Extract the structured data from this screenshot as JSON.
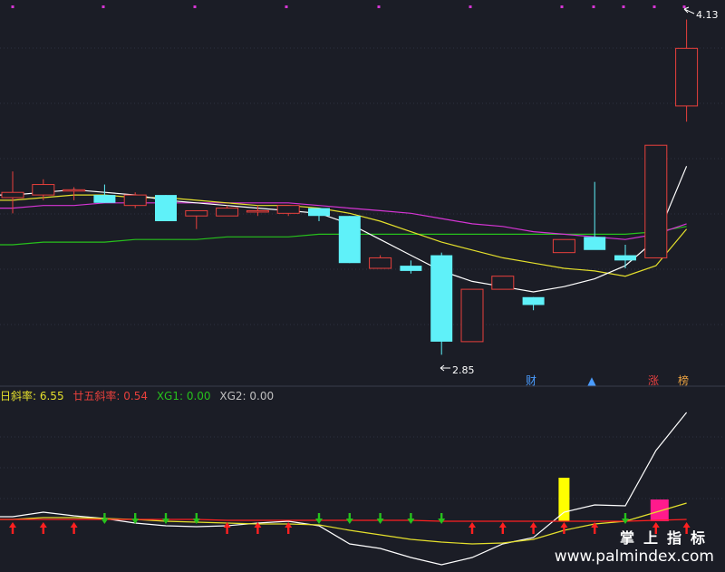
{
  "colors": {
    "background": "#1b1d26",
    "grid": "#2e3140",
    "up": "#e8403c",
    "down": "#5ff1f9",
    "ma5": "#ffffff",
    "ma10": "#e5e02c",
    "ma20": "#d535d4",
    "ma60": "#27c11c",
    "marker": "#d535d4",
    "badge_red": "#e34040",
    "badge_orange": "#e8a040",
    "badge_blue": "#4a9cff"
  },
  "price_labels": {
    "high": "4.13",
    "low": "2.85"
  },
  "badges": [
    {
      "text": "财",
      "color": "#4a9cff"
    },
    {
      "text": "▲",
      "color": "#4a9cff"
    },
    {
      "text": "涨",
      "color": "#e34040"
    },
    {
      "text": "榜",
      "color": "#e8a040"
    }
  ],
  "indicator": {
    "items": [
      {
        "label": "日斜率: ",
        "value": "6.55",
        "color": "#e5e02c"
      },
      {
        "label": "廿五斜率: ",
        "value": "0.54",
        "color": "#e8403c"
      },
      {
        "label": "XG1: ",
        "value": "0.00",
        "color": "#27c11c"
      },
      {
        "label": "XG2: ",
        "value": "0.00",
        "color": "#c0c0c0"
      }
    ]
  },
  "watermark": {
    "cn": "掌上指标",
    "url": "www.palmindex.com"
  },
  "chart_data": {
    "type": "candlestick",
    "ohlc": [
      {
        "open": 3.45,
        "high": 3.55,
        "low": 3.39,
        "close": 3.47
      },
      {
        "open": 3.46,
        "high": 3.52,
        "low": 3.44,
        "close": 3.5
      },
      {
        "open": 3.48,
        "high": 3.49,
        "low": 3.44,
        "close": 3.48
      },
      {
        "open": 3.46,
        "high": 3.5,
        "low": 3.43,
        "close": 3.43
      },
      {
        "open": 3.42,
        "high": 3.47,
        "low": 3.41,
        "close": 3.46
      },
      {
        "open": 3.46,
        "high": 3.46,
        "low": 3.36,
        "close": 3.36
      },
      {
        "open": 3.38,
        "high": 3.4,
        "low": 3.33,
        "close": 3.4
      },
      {
        "open": 3.38,
        "high": 3.42,
        "low": 3.38,
        "close": 3.41
      },
      {
        "open": 3.4,
        "high": 3.42,
        "low": 3.38,
        "close": 3.4
      },
      {
        "open": 3.39,
        "high": 3.42,
        "low": 3.38,
        "close": 3.42
      },
      {
        "open": 3.41,
        "high": 3.41,
        "low": 3.36,
        "close": 3.38
      },
      {
        "open": 3.38,
        "high": 3.38,
        "low": 3.2,
        "close": 3.2
      },
      {
        "open": 3.18,
        "high": 3.23,
        "low": 3.18,
        "close": 3.22
      },
      {
        "open": 3.19,
        "high": 3.21,
        "low": 3.16,
        "close": 3.17
      },
      {
        "open": 3.23,
        "high": 3.24,
        "low": 2.85,
        "close": 2.9
      },
      {
        "open": 2.9,
        "high": 3.1,
        "low": 2.9,
        "close": 3.1
      },
      {
        "open": 3.1,
        "high": 3.14,
        "low": 3.1,
        "close": 3.15
      },
      {
        "open": 3.07,
        "high": 3.07,
        "low": 3.02,
        "close": 3.04
      },
      {
        "open": 3.24,
        "high": 3.29,
        "low": 3.24,
        "close": 3.29
      },
      {
        "open": 3.3,
        "high": 3.51,
        "low": 3.28,
        "close": 3.25
      },
      {
        "open": 3.23,
        "high": 3.27,
        "low": 3.18,
        "close": 3.21
      },
      {
        "open": 3.22,
        "high": 3.65,
        "low": 3.22,
        "close": 3.65
      },
      {
        "open": 3.8,
        "high": 4.13,
        "low": 3.74,
        "close": 4.02
      }
    ],
    "ma5": [
      3.46,
      3.47,
      3.48,
      3.47,
      3.46,
      3.44,
      3.43,
      3.42,
      3.41,
      3.4,
      3.39,
      3.35,
      3.29,
      3.23,
      3.17,
      3.13,
      3.11,
      3.09,
      3.11,
      3.14,
      3.19,
      3.29,
      3.57
    ],
    "ma10": [
      3.44,
      3.45,
      3.46,
      3.46,
      3.45,
      3.45,
      3.44,
      3.43,
      3.42,
      3.42,
      3.41,
      3.39,
      3.36,
      3.32,
      3.28,
      3.25,
      3.22,
      3.2,
      3.18,
      3.17,
      3.15,
      3.19,
      3.33
    ],
    "ma20": [
      3.41,
      3.42,
      3.42,
      3.43,
      3.43,
      3.43,
      3.43,
      3.43,
      3.43,
      3.43,
      3.42,
      3.41,
      3.4,
      3.39,
      3.37,
      3.35,
      3.34,
      3.32,
      3.31,
      3.3,
      3.29,
      3.31,
      3.35
    ],
    "ma60": [
      3.27,
      3.28,
      3.28,
      3.28,
      3.29,
      3.29,
      3.29,
      3.3,
      3.3,
      3.3,
      3.31,
      3.31,
      3.31,
      3.31,
      3.31,
      3.31,
      3.31,
      3.31,
      3.31,
      3.31,
      3.31,
      3.32,
      3.34
    ],
    "ylim": [
      2.82,
      4.17
    ],
    "indicator_white": [
      0.05,
      0.1,
      0.06,
      0.03,
      -0.02,
      -0.05,
      -0.06,
      -0.05,
      -0.02,
      0.0,
      -0.05,
      -0.25,
      -0.3,
      -0.4,
      -0.48,
      -0.4,
      -0.25,
      -0.18,
      0.1,
      0.18,
      0.17,
      0.78,
      1.2
    ],
    "indicator_yellow": [
      0.02,
      0.04,
      0.04,
      0.03,
      0.02,
      0.0,
      -0.01,
      -0.02,
      -0.03,
      -0.03,
      -0.04,
      -0.1,
      -0.15,
      -0.2,
      -0.23,
      -0.25,
      -0.24,
      -0.2,
      -0.1,
      -0.03,
      0.0,
      0.1,
      0.2
    ],
    "indicator_red": [
      0.02,
      0.02,
      0.02,
      0.02,
      0.02,
      0.02,
      0.02,
      0.01,
      0.01,
      0.01,
      0.01,
      0.01,
      0.01,
      0.01,
      0.0,
      0.0,
      0.0,
      0.0,
      0.0,
      0.0,
      0.0,
      0.01,
      0.02
    ],
    "bars": [
      {
        "index": 18,
        "value": 0.48,
        "color": "#ffff00"
      },
      {
        "index": 21,
        "value": 0.24,
        "color": "#ff1a8c"
      }
    ],
    "arrows": [
      "up",
      "up",
      "up",
      "down",
      "down",
      "down",
      "down",
      "up",
      "up",
      "up",
      "down",
      "down",
      "down",
      "down",
      "down",
      "up",
      "up",
      "up",
      "up",
      "up",
      "down",
      "up",
      "up"
    ],
    "ind_ylim": [
      -0.5,
      1.25
    ]
  }
}
